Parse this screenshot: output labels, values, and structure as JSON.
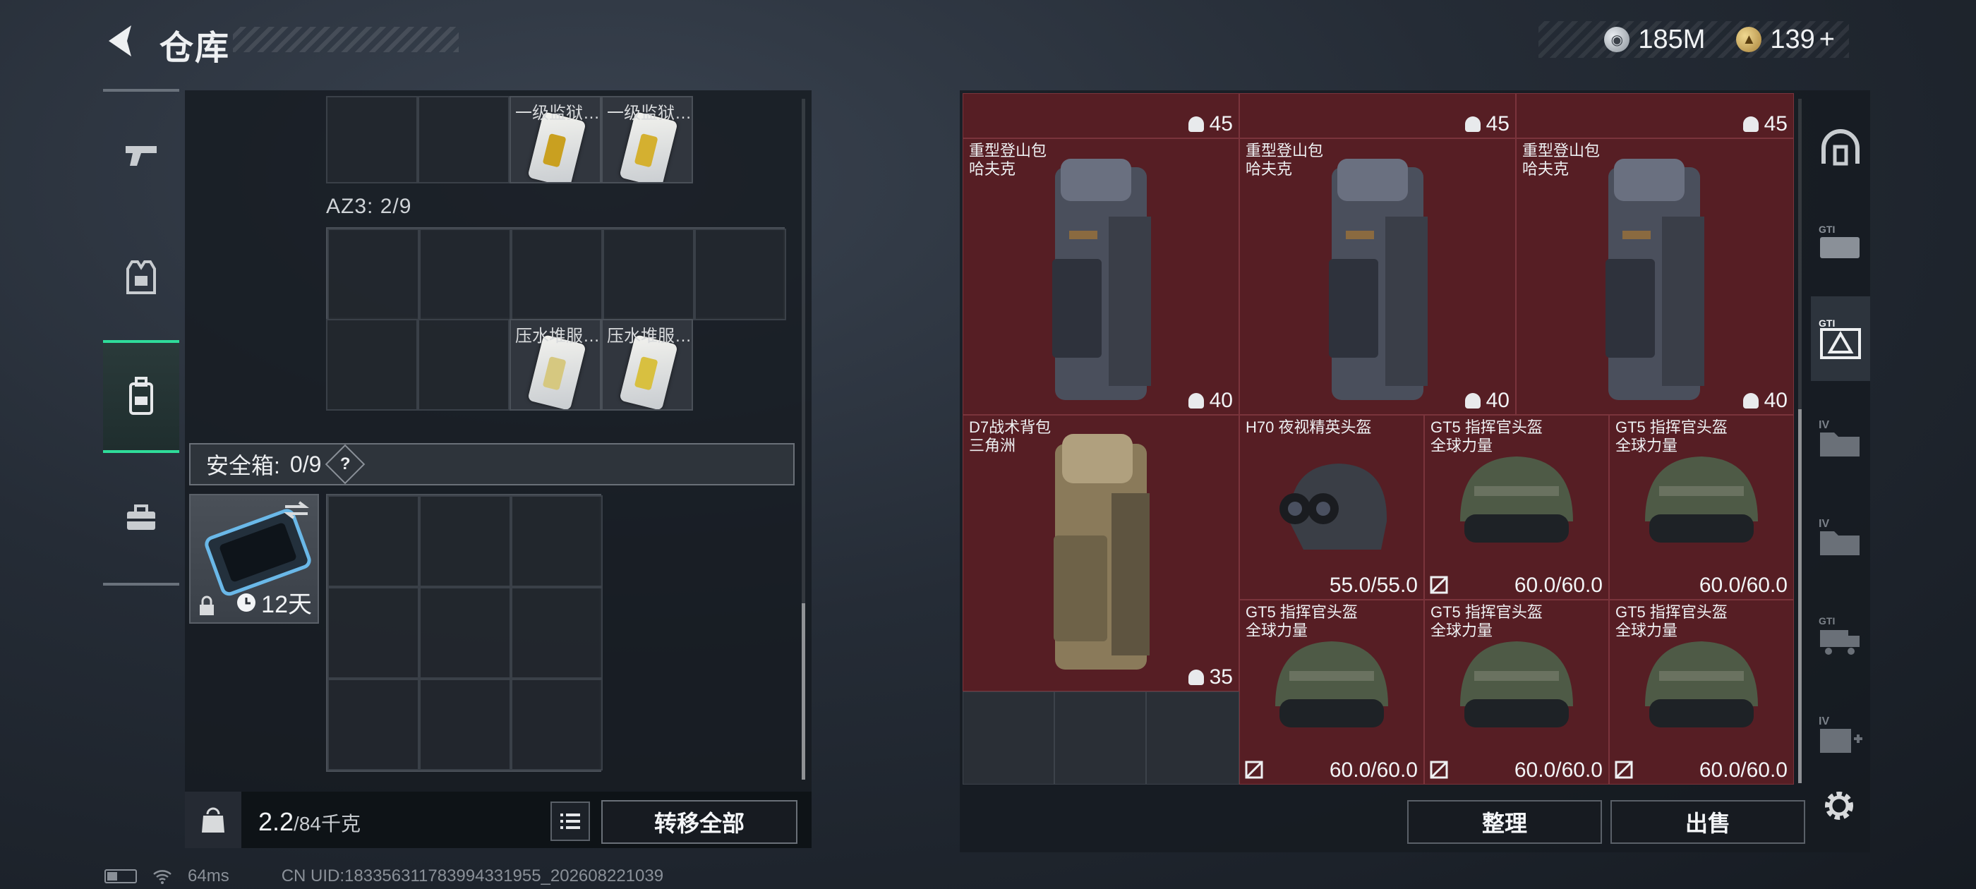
{
  "header": {
    "title": "仓库",
    "currency_silver": "185M",
    "currency_gold": "139",
    "currency_plus": "+"
  },
  "left_categories": [
    {
      "name": "weapons",
      "icon": "pistol-icon"
    },
    {
      "name": "armor",
      "icon": "vest-icon"
    },
    {
      "name": "backpack",
      "icon": "backpack-icon",
      "active": true
    },
    {
      "name": "toolbox",
      "icon": "toolbox-icon"
    }
  ],
  "inventory": {
    "top_items": [
      {
        "label": "一级监狱…",
        "chip_color": "#c9a020"
      },
      {
        "label": "一级监狱…",
        "chip_color": "#d4b030"
      }
    ],
    "az3_label": "AZ3: 2/9",
    "az3_items": [
      {
        "label": "压水堆服…",
        "chip_color": "#d6c880"
      },
      {
        "label": "压水堆服…",
        "chip_color": "#d8c040"
      }
    ],
    "safe_box_label": "安全箱:",
    "safe_box_count": "0/9",
    "safe_box_help": "?",
    "safe_item_days": "12天"
  },
  "footer": {
    "weight_value": "2.2",
    "weight_capacity": "/84千克",
    "transfer_all": "转移全部"
  },
  "storage": {
    "top_row_qty": [
      "45",
      "45",
      "45"
    ],
    "backpacks": [
      {
        "name": "重型登山包",
        "brand": "哈夫克",
        "qty": "40"
      },
      {
        "name": "重型登山包",
        "brand": "哈夫克",
        "qty": "40"
      },
      {
        "name": "重型登山包",
        "brand": "哈夫克",
        "qty": "40"
      }
    ],
    "d7": {
      "name": "D7战术背包",
      "brand": "三角洲",
      "qty": "35"
    },
    "helmets_row1": [
      {
        "name": "H70 夜视精英头盔",
        "brand": "",
        "durability": "55.0/55.0",
        "nodrop": false
      },
      {
        "name": "GT5 指挥官头盔",
        "brand": "全球力量",
        "durability": "60.0/60.0",
        "nodrop": true
      },
      {
        "name": "GT5 指挥官头盔",
        "brand": "全球力量",
        "durability": "60.0/60.0",
        "nodrop": false
      }
    ],
    "helmets_row2": [
      {
        "name": "GT5 指挥官头盔",
        "brand": "全球力量",
        "durability": "60.0/60.0",
        "nodrop": true
      },
      {
        "name": "GT5 指挥官头盔",
        "brand": "全球力量",
        "durability": "60.0/60.0",
        "nodrop": true
      },
      {
        "name": "GT5 指挥官头盔",
        "brand": "全球力量",
        "durability": "60.0/60.0",
        "nodrop": true
      }
    ],
    "sort": "整理",
    "sell": "出售"
  },
  "right_categories": [
    {
      "name": "home",
      "icon": "dome-icon",
      "label": ""
    },
    {
      "name": "gt1-a",
      "icon": "gt-card-icon",
      "label": "GTI"
    },
    {
      "name": "gt1-b",
      "icon": "gt-warning-icon",
      "label": "GTI",
      "active": true
    },
    {
      "name": "iv-a",
      "icon": "iv-folder-icon",
      "label": "IV"
    },
    {
      "name": "iv-b",
      "icon": "iv-folder-icon",
      "label": "IV"
    },
    {
      "name": "gt1-c",
      "icon": "gt-truck-icon",
      "label": "GTI"
    },
    {
      "name": "iv-c",
      "icon": "iv-medkit-icon",
      "label": "IV"
    }
  ],
  "status": {
    "ping": "64ms",
    "uid": "CN UID:18335631178399433195​5_202608221039"
  },
  "colors": {
    "accent_green": "#2fdc9a",
    "storage_cell": "#561e24"
  }
}
